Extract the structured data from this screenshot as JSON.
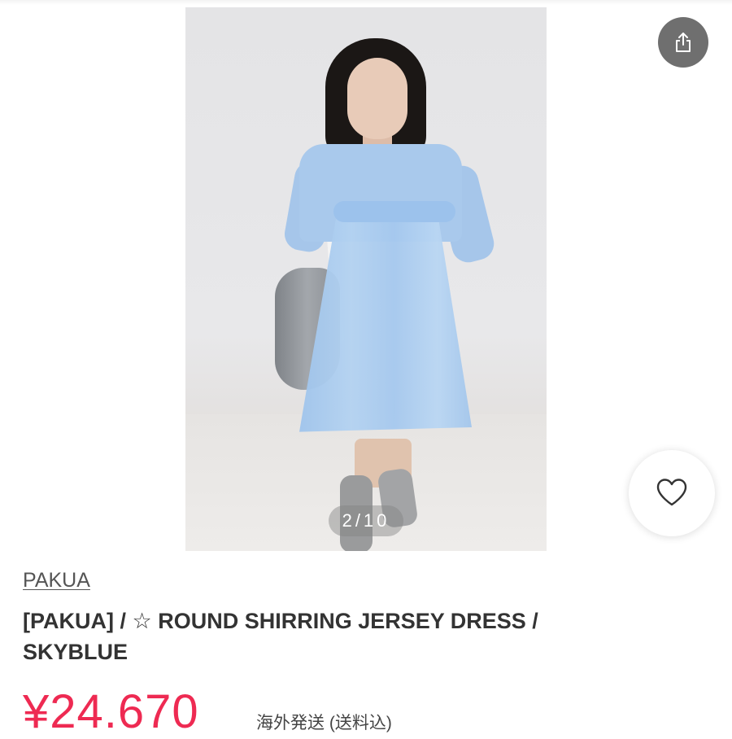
{
  "gallery": {
    "counter": "2/10",
    "image_alt": "Model wearing sky blue round shirring jersey dress"
  },
  "actions": {
    "share_icon": "share-icon",
    "favorite_icon": "heart-icon"
  },
  "product": {
    "brand": "PAKUA",
    "title_line1": "[PAKUA] / ☆ ROUND SHIRRING JERSEY DRESS /",
    "title_line2": "SKYBLUE",
    "price": "¥24.670",
    "shipping_note": "海外発送 (送料込)"
  },
  "colors": {
    "price": "#ee2a52",
    "share_button_bg": "#6f6f6f",
    "photo_bg": "#e5e5e7"
  }
}
